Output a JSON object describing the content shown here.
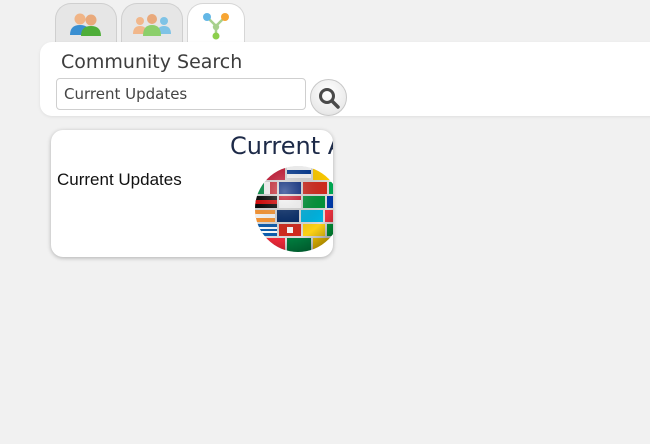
{
  "tabs": [
    {
      "name": "people-tab",
      "icon": "users-icon",
      "active": false
    },
    {
      "name": "groups-tab",
      "icon": "community-icon",
      "active": false
    },
    {
      "name": "network-tab",
      "icon": "network-icon",
      "active": true
    }
  ],
  "search": {
    "title": "Community Search",
    "value": "Current Updates",
    "placeholder": "",
    "button_icon": "search-icon"
  },
  "card": {
    "banner_text": "Current Affairs",
    "label": "Current Updates",
    "image_icon": "flag-globe-icon"
  },
  "colors": {
    "background": "#f1f1f1",
    "panel": "#ffffff",
    "banner_text": "#1d2a48"
  }
}
